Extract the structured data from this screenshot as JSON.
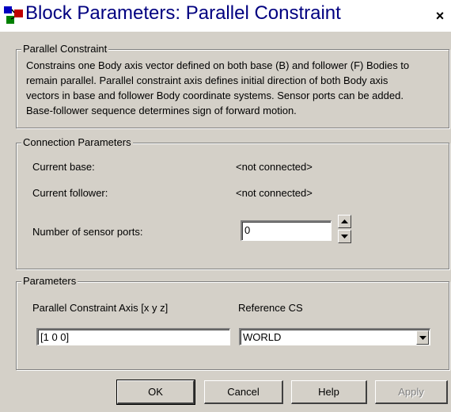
{
  "window": {
    "title": "Block Parameters: Parallel Constraint",
    "close_glyph": "×",
    "app_icon": "simulink-block-icon"
  },
  "description": {
    "legend": "Parallel Constraint",
    "text": "Constrains one Body axis vector defined on both base (B) and follower (F) Bodies to\nremain parallel. Parallel constraint axis defines initial direction of both Body axis\nvectors in base and follower Body coordinate systems. Sensor ports can be added.\nBase-follower sequence determines sign of forward motion."
  },
  "connection": {
    "legend": "Connection Parameters",
    "current_base_label": "Current base:",
    "current_base_value": "<not connected>",
    "current_follower_label": "Current follower:",
    "current_follower_value": "<not connected>",
    "sensor_ports_label": "Number of sensor ports:",
    "sensor_ports_value": "0"
  },
  "parameters": {
    "legend": "Parameters",
    "axis_label": "Parallel Constraint Axis [x y z]",
    "axis_value": "[1 0 0]",
    "reference_label": "Reference CS",
    "reference_value": "WORLD"
  },
  "buttons": {
    "ok": "OK",
    "cancel": "Cancel",
    "help": "Help",
    "apply": "Apply"
  }
}
